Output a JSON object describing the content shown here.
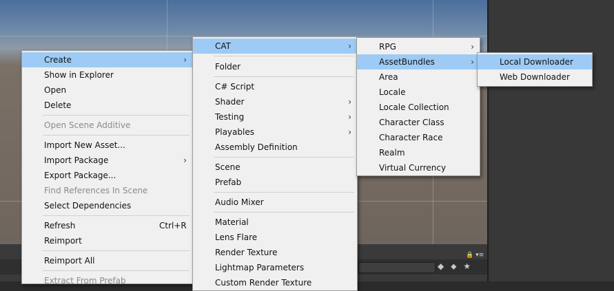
{
  "menu1": {
    "items": [
      "Create",
      "Show in Explorer",
      "Open",
      "Delete",
      "Open Scene Additive",
      "Import New Asset...",
      "Import Package",
      "Export Package...",
      "Find References In Scene",
      "Select Dependencies",
      "Refresh",
      "Reimport",
      "Reimport All",
      "Extract From Prefab"
    ],
    "refresh_shortcut": "Ctrl+R"
  },
  "menu2": {
    "items": [
      "CAT",
      "Folder",
      "C# Script",
      "Shader",
      "Testing",
      "Playables",
      "Assembly Definition",
      "Scene",
      "Prefab",
      "Audio Mixer",
      "Material",
      "Lens Flare",
      "Render Texture",
      "Lightmap Parameters",
      "Custom Render Texture"
    ]
  },
  "menu3": {
    "items": [
      "RPG",
      "AssetBundles",
      "Area",
      "Locale",
      "Locale Collection",
      "Character Class",
      "Character Race",
      "Realm",
      "Virtual Currency"
    ]
  },
  "menu4": {
    "items": [
      "Local Downloader",
      "Web Downloader"
    ]
  },
  "submenu_arrow": "›",
  "icons": [
    "lock-icon",
    "menu-dropdown-icon",
    "labels-icon",
    "tag-icon",
    "star-icon"
  ],
  "colors": {
    "highlight": "#9ecbf6",
    "menu_bg": "#f0f0f0",
    "disabled_text": "#8a8a8a"
  }
}
